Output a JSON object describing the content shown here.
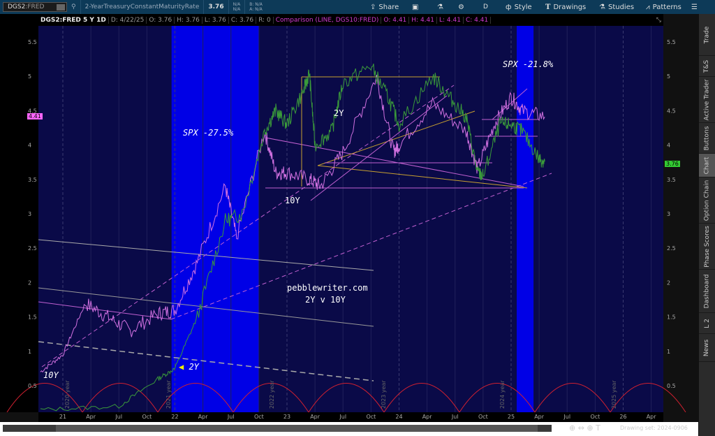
{
  "toolbar": {
    "symbol": "DGS2",
    "symbol_suffix": ":FRED",
    "description": "2-YearTreasuryConstantMaturityRate",
    "last": "3.76",
    "na1": "N/A",
    "na2": "N/A",
    "bid": "B: N/A",
    "ask": "A: N/A",
    "share": "Share",
    "timeframe": "D",
    "style": "Style",
    "drawings": "Drawings",
    "studies": "Studies",
    "patterns": "Patterns"
  },
  "header": {
    "title": "DGS2:FRED 5 Y 1D",
    "date": "D: 4/22/25",
    "open": "O: 3.76",
    "high": "H: 3.76",
    "low": "L: 3.76",
    "close": "C: 3.76",
    "range": "R: 0",
    "comparison": "Comparison (LINE, DGS10:FRED)",
    "c_open": "O: 4.41",
    "c_high": "H: 4.41",
    "c_low": "L: 4.41",
    "c_close": "C: 4.41"
  },
  "price_tags": {
    "left": "4.41",
    "right": "3.76",
    "left_color": "#ff66ff",
    "right_color": "#33cc33"
  },
  "annotations": {
    "spx1": "SPX -27.5%",
    "spx2": "SPX -21.8%",
    "label_2y": "2Y",
    "label_10y": "10Y",
    "label_10y_left": "10Y",
    "label_2y_arrow": "2Y",
    "site": "pebblewriter.com",
    "subtitle": "2Y v 10Y",
    "year_labels": [
      "2020 year",
      "2021 year",
      "2022 year",
      "2023 year",
      "2024 year",
      "2025 year"
    ]
  },
  "footer": {
    "drawing_set": "Drawing set: 2024-0906"
  },
  "sidebar": [
    "Trade",
    "T&S",
    "Active Trader",
    "Buttons",
    "Chart",
    "Option Chain",
    "Phase Scores",
    "Dashboard",
    "L 2",
    "News"
  ],
  "chart_data": {
    "type": "line",
    "title": "DGS2:FRED 5 Y 1D vs DGS10:FRED",
    "ylim": [
      0.15,
      5.8
    ],
    "y_ticks": [
      "5.5",
      "5",
      "4.5",
      "4",
      "3.5",
      "3",
      "2.5",
      "2",
      "1.5",
      "1",
      "0.5"
    ],
    "x_ticks": [
      "21",
      "Apr",
      "Jul",
      "Oct",
      "22",
      "Apr",
      "Jul",
      "Oct",
      "23",
      "Apr",
      "Jul",
      "Oct",
      "24",
      "Apr",
      "Jul",
      "Oct",
      "25",
      "Apr",
      "Jul",
      "Oct",
      "26",
      "Apr"
    ],
    "series": [
      {
        "name": "DGS2 (2Y)",
        "color": "#3a9a3a",
        "x": [
          2020.8,
          2021.5,
          2021.85,
          2022.0,
          2022.2,
          2022.45,
          2022.6,
          2022.8,
          2022.9,
          2023.0,
          2023.15,
          2023.2,
          2023.25,
          2023.4,
          2023.5,
          2023.75,
          2023.9,
          2024.0,
          2024.3,
          2024.45,
          2024.6,
          2024.7,
          2024.75,
          2024.9,
          2025.0,
          2025.1,
          2025.25,
          2025.3
        ],
        "y": [
          0.15,
          0.2,
          0.6,
          0.75,
          1.5,
          2.9,
          3.0,
          4.2,
          4.5,
          4.3,
          4.8,
          5.05,
          4.0,
          4.2,
          4.9,
          5.15,
          4.7,
          4.3,
          5.0,
          4.7,
          4.4,
          3.6,
          3.55,
          4.3,
          4.3,
          4.2,
          3.8,
          3.76
        ]
      },
      {
        "name": "DGS10 (10Y)",
        "color": "#d070e0",
        "x": [
          2020.8,
          2021.0,
          2021.2,
          2021.4,
          2021.6,
          2021.85,
          2022.0,
          2022.2,
          2022.45,
          2022.55,
          2022.8,
          2022.9,
          2023.0,
          2023.2,
          2023.3,
          2023.5,
          2023.8,
          2023.95,
          2024.0,
          2024.3,
          2024.6,
          2024.7,
          2024.85,
          2025.0,
          2025.1,
          2025.3
        ],
        "y": [
          0.7,
          0.95,
          1.7,
          1.5,
          1.3,
          1.55,
          1.6,
          2.3,
          3.4,
          2.65,
          4.2,
          3.6,
          3.6,
          3.5,
          3.4,
          3.9,
          5.0,
          3.9,
          4.0,
          4.6,
          4.2,
          3.65,
          4.3,
          4.7,
          4.5,
          4.41
        ]
      }
    ],
    "highlight_bands": [
      [
        2021.97,
        2022.75
      ],
      [
        2025.05,
        2025.2
      ]
    ]
  }
}
